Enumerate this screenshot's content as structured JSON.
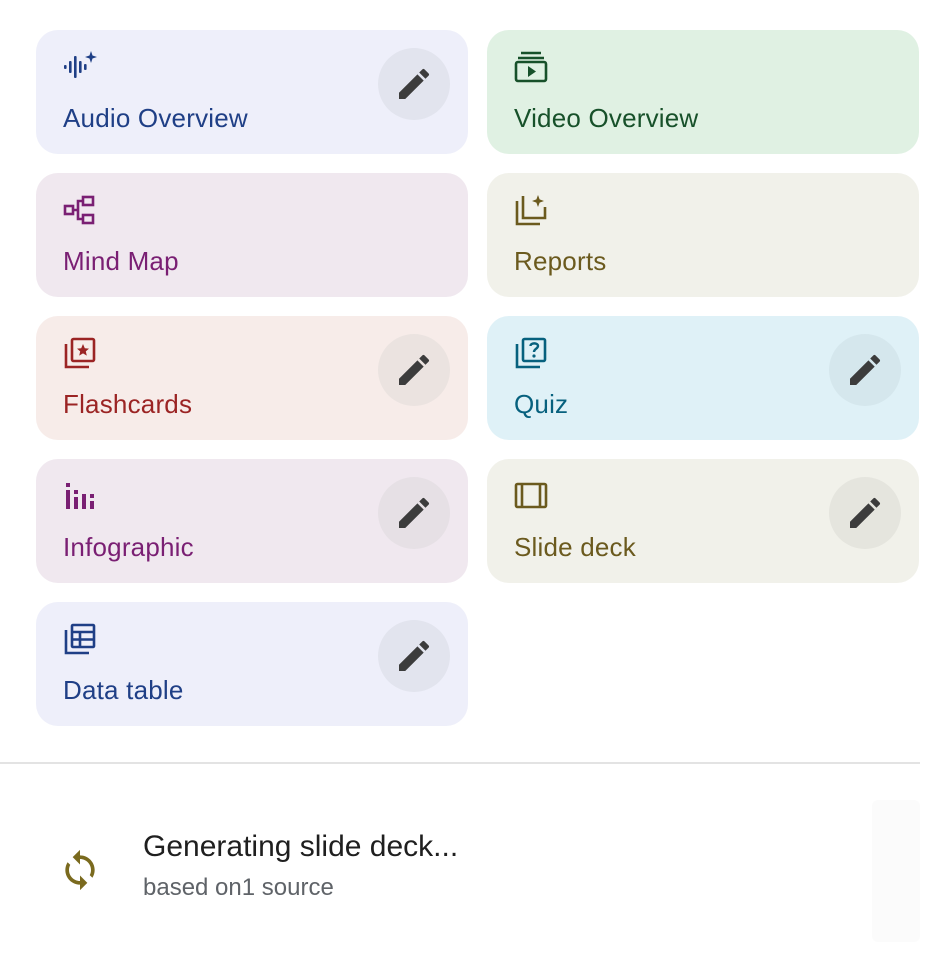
{
  "tiles": [
    {
      "label": "Audio Overview",
      "icon": "audio-waveform-sparkle-icon",
      "editable": true
    },
    {
      "label": "Video Overview",
      "icon": "video-stack-play-icon",
      "editable": false
    },
    {
      "label": "Mind Map",
      "icon": "mind-map-icon",
      "editable": false
    },
    {
      "label": "Reports",
      "icon": "report-sparkle-icon",
      "editable": false
    },
    {
      "label": "Flashcards",
      "icon": "flashcards-star-icon",
      "editable": true
    },
    {
      "label": "Quiz",
      "icon": "quiz-question-icon",
      "editable": true
    },
    {
      "label": "Infographic",
      "icon": "infographic-bars-icon",
      "editable": true
    },
    {
      "label": "Slide deck",
      "icon": "slide-deck-icon",
      "editable": true
    },
    {
      "label": "Data table",
      "icon": "data-table-icon",
      "editable": true
    }
  ],
  "status": {
    "title": "Generating slide deck...",
    "subtitle": "based on1 source",
    "icon": "sync-refresh-icon"
  },
  "colors": {
    "audio": "#1f3f86",
    "video": "#17512a",
    "mind_map": "#7a1f73",
    "reports": "#6b5a1e",
    "flashcards": "#9b2424",
    "quiz": "#07617e",
    "status_icon": "#7a6a1e"
  }
}
